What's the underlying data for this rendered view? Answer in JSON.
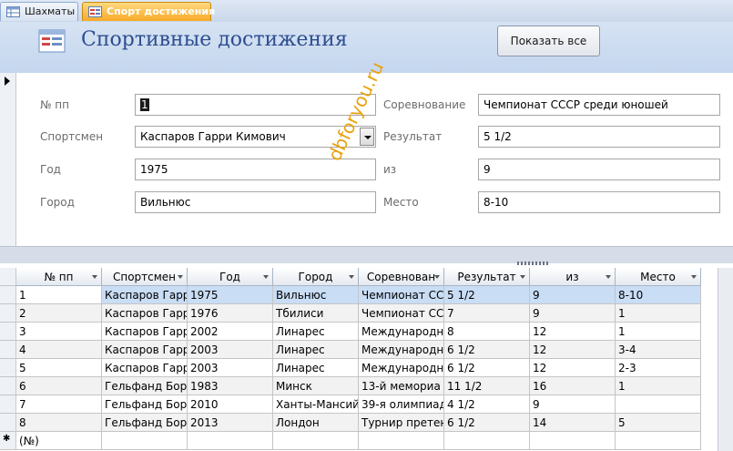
{
  "tabs": [
    {
      "label": "Шахматы",
      "icon": "table-icon",
      "active": false
    },
    {
      "label": "Спорт достижения",
      "icon": "form-icon",
      "active": true
    }
  ],
  "header": {
    "title": "Спортивные достижения",
    "show_all_label": "Показать все",
    "icon": "form-icon"
  },
  "form": {
    "labels": {
      "num": "№ пп",
      "athlete": "Спортсмен",
      "year": "Год",
      "city": "Город",
      "competition": "Соревнование",
      "result": "Результат",
      "of": "из",
      "place": "Место"
    },
    "values": {
      "num": "1",
      "athlete": "Каспаров Гарри Кимович",
      "year": "1975",
      "city": "Вильнюс",
      "competition": "Чемпионат СССР среди юношей",
      "result": "5 1/2",
      "of": "9",
      "place": "8-10"
    }
  },
  "watermark": "dbforyou.ru",
  "grid": {
    "columns": [
      "№ пп",
      "Спортсмен",
      "Год",
      "Город",
      "Соревнован",
      "Результат",
      "из",
      "Место"
    ],
    "rows": [
      [
        "1",
        "Каспаров Гарр",
        "1975",
        "Вильнюс",
        "Чемпионат СС",
        "5 1/2",
        "9",
        "8-10"
      ],
      [
        "2",
        "Каспаров Гарр",
        "1976",
        "Тбилиси",
        "Чемпионат СС",
        "7",
        "9",
        "1"
      ],
      [
        "3",
        "Каспаров Гарр",
        "2002",
        "Линарес",
        "Международн",
        "8",
        "12",
        "1"
      ],
      [
        "4",
        "Каспаров Гарр",
        "2003",
        "Линарес",
        "Международн",
        "6 1/2",
        "12",
        "3-4"
      ],
      [
        "5",
        "Каспаров Гарр",
        "2003",
        "Линарес",
        "Международн",
        "6 1/2",
        "12",
        "2-3"
      ],
      [
        "6",
        "Гельфанд Бор",
        "1983",
        "Минск",
        "13-й мемориа",
        "11 1/2",
        "16",
        "1"
      ],
      [
        "7",
        "Гельфанд Бор",
        "2010",
        "Ханты-Мансий",
        "39-я олимпиад",
        "4  1/2",
        "9",
        ""
      ],
      [
        "8",
        "Гельфанд Бор",
        "2013",
        "Лондон",
        "Турнир претен",
        "6 1/2",
        "14",
        "5"
      ]
    ],
    "new_row_label": "(№)"
  },
  "colors": {
    "header_bg": "#c4d6ee",
    "title": "#2d4e8f",
    "active_tab": "#f7a928",
    "selected_row": "#c9ddf5",
    "watermark": "#e7a20f"
  }
}
